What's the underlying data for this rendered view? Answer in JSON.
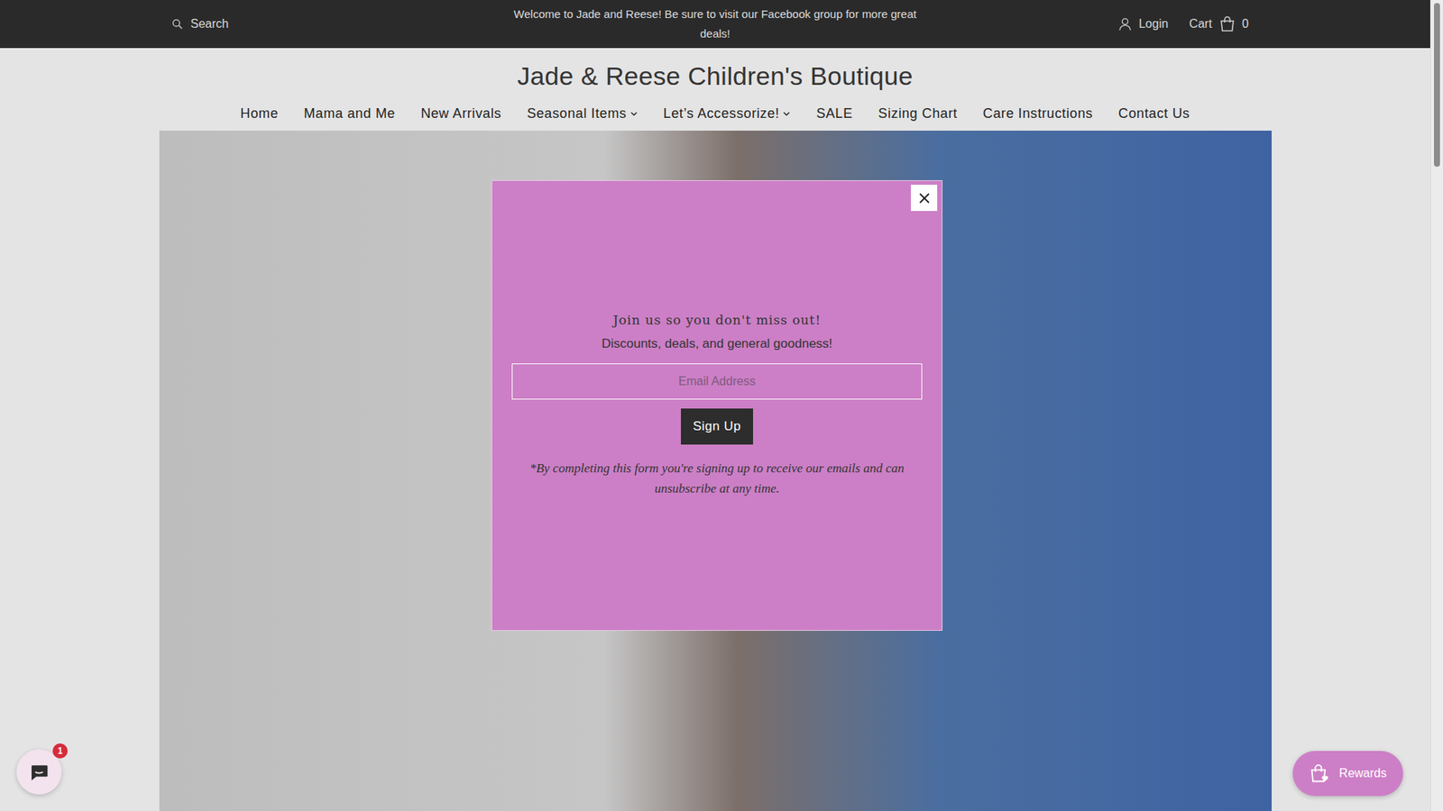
{
  "topbar": {
    "search": {
      "placeholder": "Search"
    },
    "announcement": "Welcome to Jade and Reese! Be sure to visit our Facebook group for more great deals!",
    "login": "Login",
    "cart": {
      "label": "Cart",
      "count": "0"
    }
  },
  "store_title": "Jade & Reese Children's Boutique",
  "nav": [
    {
      "label": "Home",
      "has_dropdown": false
    },
    {
      "label": "Mama and Me",
      "has_dropdown": false
    },
    {
      "label": "New Arrivals",
      "has_dropdown": false
    },
    {
      "label": "Seasonal Items",
      "has_dropdown": true
    },
    {
      "label": "Let’s Accessorize!",
      "has_dropdown": true
    },
    {
      "label": "SALE",
      "has_dropdown": false
    },
    {
      "label": "Sizing Chart",
      "has_dropdown": false
    },
    {
      "label": "Care Instructions",
      "has_dropdown": false
    },
    {
      "label": "Contact Us",
      "has_dropdown": false
    }
  ],
  "popup": {
    "heading": "Join us so you don't miss out!",
    "subheading": "Discounts, deals, and general goodness!",
    "email": {
      "placeholder": "Email Address"
    },
    "button": "Sign Up",
    "disclaimer": "*By completing this form you're signing up to receive our emails and can unsubscribe at any time."
  },
  "chat": {
    "badge": "1"
  },
  "rewards": {
    "label": "Rewards"
  }
}
